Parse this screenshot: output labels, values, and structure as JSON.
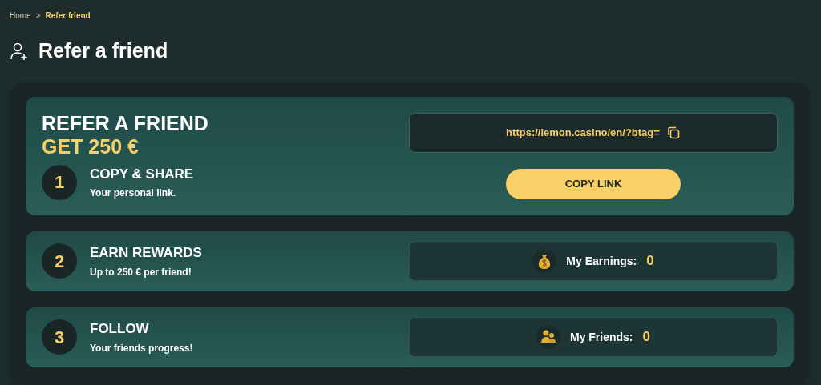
{
  "breadcrumb": [
    {
      "label": "Home",
      "selected": false
    },
    {
      "label": "Refer friend",
      "selected": true
    }
  ],
  "breadcrumb_separator": ">",
  "page_title": "Refer a friend",
  "hero": {
    "title": "REFER A FRIEND",
    "subtitle": "GET 250 €"
  },
  "steps": [
    {
      "kind": "link",
      "number": "1",
      "title": "COPY & SHARE",
      "description": "Your personal link.",
      "link": "https://lemon.casino/en/?btag=",
      "button": "COPY LINK"
    },
    {
      "kind": "earnings",
      "number": "2",
      "title": "EARN REWARDS",
      "description": "Up to 250 € per friend!",
      "label": "My Earnings:",
      "value": "0"
    },
    {
      "kind": "friends",
      "number": "3",
      "title": "FOLLOW",
      "description": "Your friends progress!",
      "label": "My Friends:",
      "value": "0"
    }
  ]
}
